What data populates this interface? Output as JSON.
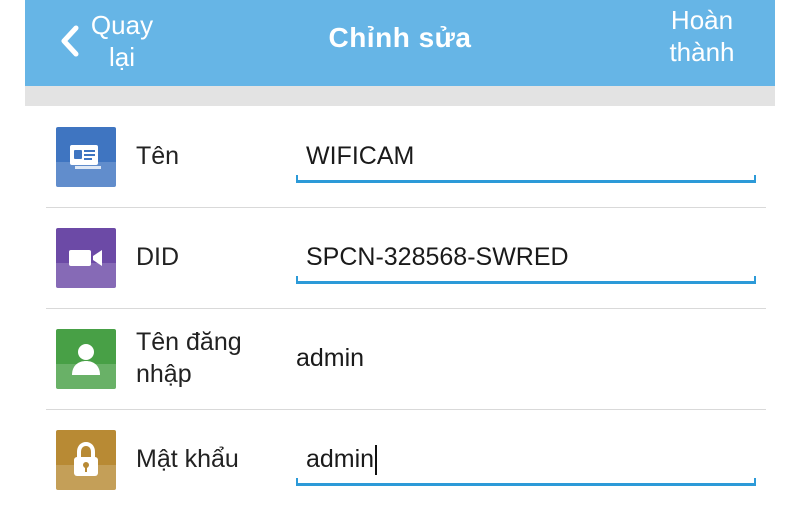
{
  "header": {
    "back_label": "Quay lại",
    "title": "Chỉnh sửa",
    "done_label": "Hoàn thành"
  },
  "fields": [
    {
      "label": "Tên",
      "value": "WIFICAM",
      "icon": "id-card-icon",
      "color": "#3f75c1"
    },
    {
      "label": "DID",
      "value": "SPCN-328568-SWRED",
      "icon": "video-camera-icon",
      "color": "#6c4aa6"
    },
    {
      "label": "Tên đăng nhập",
      "value": "admin",
      "icon": "user-icon",
      "color": "#48a046"
    },
    {
      "label": "Mật khẩu",
      "value": "admin",
      "icon": "lock-icon",
      "color": "#b88a34"
    }
  ],
  "colors": {
    "header_bg": "#66b5e6",
    "accent": "#2c9ad8"
  }
}
